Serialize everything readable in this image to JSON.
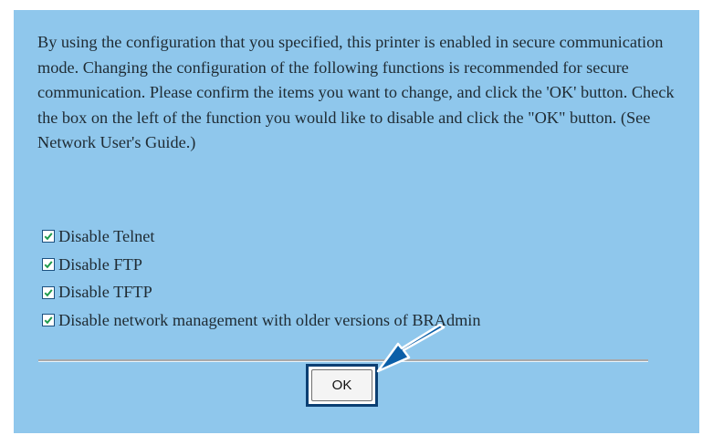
{
  "message": "By using the configuration that you specified, this printer is enabled in secure communication mode. Changing the configuration of the following functions is recommended for secure communication. Please confirm the items you want to change, and click the 'OK' button. Check the box on the left of the function you would like to disable and click the \"OK\" button. (See Network User's Guide.)",
  "options": [
    {
      "label": "Disable Telnet",
      "checked": true
    },
    {
      "label": "Disable FTP",
      "checked": true
    },
    {
      "label": "Disable TFTP",
      "checked": true
    },
    {
      "label": "Disable network management with older versions of BRAdmin",
      "checked": true
    }
  ],
  "ok_button": {
    "label": "OK"
  },
  "colors": {
    "panel_background": "#8fc7ec",
    "highlight_border": "#0b3f73",
    "checkmark": "#1f9a4c",
    "arrow": "#0b5fa8"
  },
  "icons": {
    "checkbox": "checkbox-checked-icon",
    "pointer": "arrow-pointer-icon"
  }
}
